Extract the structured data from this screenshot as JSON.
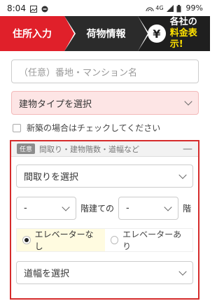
{
  "status": {
    "time": "8:04",
    "network": "4G",
    "battery": "99%"
  },
  "steps": {
    "step1": "住所入力",
    "step2": "荷物情報",
    "step3_line1": "各社の",
    "step3_line2": "料金表示!",
    "yen": "¥"
  },
  "form": {
    "address_placeholder": "（任意）番地・マンション名",
    "building_type": "建物タイプを選択",
    "new_build_check": "新築の場合はチェックしてください"
  },
  "optional": {
    "badge": "任意",
    "title": "間取り・建物階数・道幅など",
    "collapse": "—",
    "layout_select": "間取りを選択",
    "floor_select_1": "-",
    "floor_mid_label": "階建ての",
    "floor_select_2": "-",
    "floor_end_label": "階",
    "elevator_none": "エレベーターなし",
    "elevator_yes": "エレベーターあり",
    "road_width": "道幅を選択"
  },
  "colors": {
    "accent_red": "#e0202a",
    "dark": "#2b2b2b",
    "highlight_yellow": "#ffe100"
  }
}
